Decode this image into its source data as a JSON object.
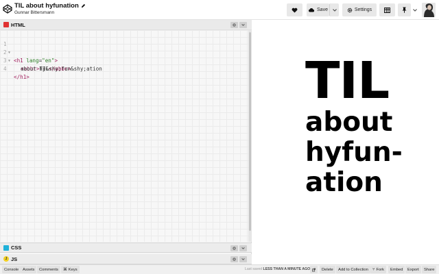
{
  "header": {
    "pen_title": "TIL about hyfunation",
    "author": "Gunnar Bittersmann",
    "buttons": {
      "save_label": "Save",
      "settings_label": "Settings"
    },
    "icons": [
      "codepen-logo-icon",
      "pencil-icon",
      "heart-icon",
      "cloud-icon",
      "chevron-down-icon",
      "gear-icon",
      "layout-icon",
      "pin-icon"
    ]
  },
  "editor": {
    "html_panel": {
      "label": "HTML",
      "lines": [
        {
          "num": "1",
          "parts": [
            "<h1",
            " lang",
            "=",
            "\"en\"",
            ">"
          ]
        },
        {
          "num": "2",
          "parts": [
            "<abbr>",
            "TIL",
            "</abbr>"
          ]
        },
        {
          "num": "3",
          "parts": [
            "about hy&shy;fun&shy;ation"
          ]
        },
        {
          "num": "4",
          "parts": [
            "</h1>"
          ]
        }
      ]
    },
    "css_panel": {
      "label": "CSS"
    },
    "js_panel": {
      "label": "JS"
    }
  },
  "preview": {
    "abbr": "TIL",
    "line1": "about",
    "line2": "hyfun-",
    "line3": "ation"
  },
  "footer": {
    "console": "Console",
    "assets": "Assets",
    "comments": "Comments",
    "keys": "Keys",
    "last_saved_prefix": "Last saved",
    "last_saved_value": "LESS THAN A MINUTE AGO",
    "delete": "Delete",
    "add_to_collection": "Add to Collection",
    "fork": "Fork",
    "embed": "Embed",
    "export": "Export",
    "share": "Share"
  },
  "colors": {
    "html_badge": "#e03131",
    "css_badge": "#1fb1d9",
    "js_badge": "#f2d023",
    "tag": "#a11d5c",
    "attr": "#2a7c23"
  }
}
